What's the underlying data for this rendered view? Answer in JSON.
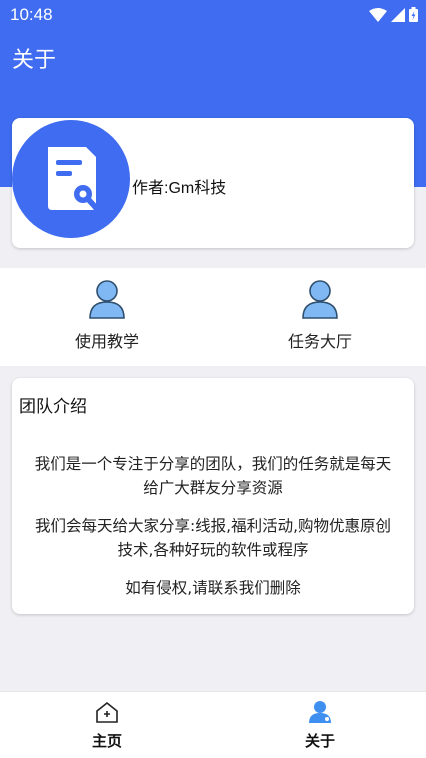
{
  "status_bar": {
    "time": "10:48"
  },
  "app_bar": {
    "title": "关于"
  },
  "author": {
    "label": "作者:Gm科技"
  },
  "quick_actions": [
    {
      "label": "使用教学",
      "icon": "user-icon"
    },
    {
      "label": "任务大厅",
      "icon": "user-icon"
    }
  ],
  "team": {
    "title": "团队介绍",
    "paragraphs": [
      "我们是一个专注于分享的团队，我们的任务就是每天给广大群友分享资源",
      "我们会每天给大家分享:线报,福利活动,购物优惠原创技术,各种好玩的软件或程序",
      "如有侵权,请联系我们删除"
    ]
  },
  "bottom_nav": [
    {
      "label": "主页",
      "icon": "home-icon",
      "active": false
    },
    {
      "label": "关于",
      "icon": "about-icon",
      "active": true
    }
  ],
  "colors": {
    "primary": "#3f6cf0",
    "avatar_tint": "#5aa0ee"
  }
}
